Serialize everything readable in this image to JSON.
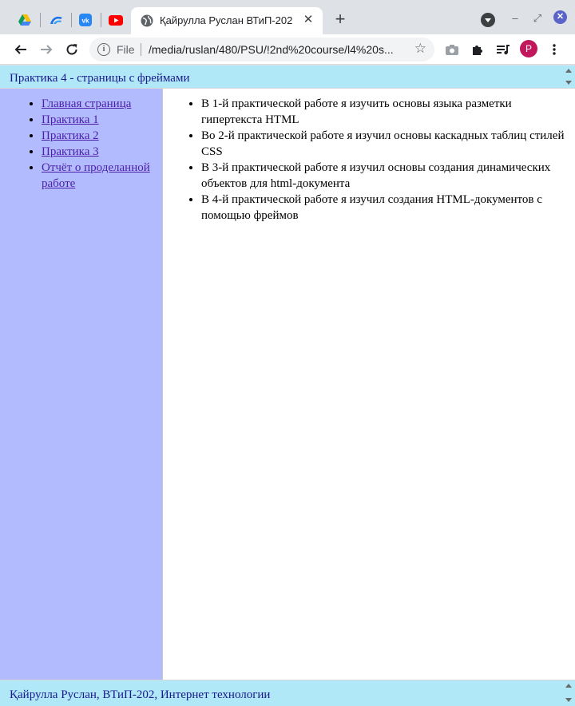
{
  "browser": {
    "pinned_tabs": [
      {
        "icon": "google-drive-icon"
      },
      {
        "icon": "cloud-app-icon"
      },
      {
        "icon": "vk-icon"
      },
      {
        "icon": "youtube-icon"
      }
    ],
    "active_tab": {
      "title": "Қайрулла Руслан ВТиП-202",
      "icon": "globe-icon"
    },
    "window_controls": {
      "minimize": "–",
      "restore": "⤢",
      "close": "✕"
    },
    "toolbar": {
      "scheme": "File",
      "url": "/media/ruslan/480/PSU/!2nd%20course/l4%20s...",
      "profile_initial": "P",
      "profile_color": "#c2185b"
    }
  },
  "page": {
    "header_text": "Практика 4 - страницы с фреймами",
    "footer_text": "Қайрулла Руслан, ВТиП-202, Интернет технологии",
    "nav_links": [
      "Главная страница",
      "Практика 1",
      "Практика 2",
      "Практика 3",
      "Отчёт о проделанной работе"
    ],
    "content_items": [
      "В 1-й практической работе я изучить основы языка разметки гипертекста HTML",
      "Во 2-й практической работе я изучил основы каскадных таблиц стилей CSS",
      "В 3-й практической работе я изучил основы создания динамических объектов для html-документа",
      "В 4-й практической работе я изучил создания HTML-документов с помощью фреймов"
    ],
    "colors": {
      "header_bg": "#b0e8f8",
      "nav_bg": "#b3bbff",
      "link": "#4b1fa8"
    }
  }
}
